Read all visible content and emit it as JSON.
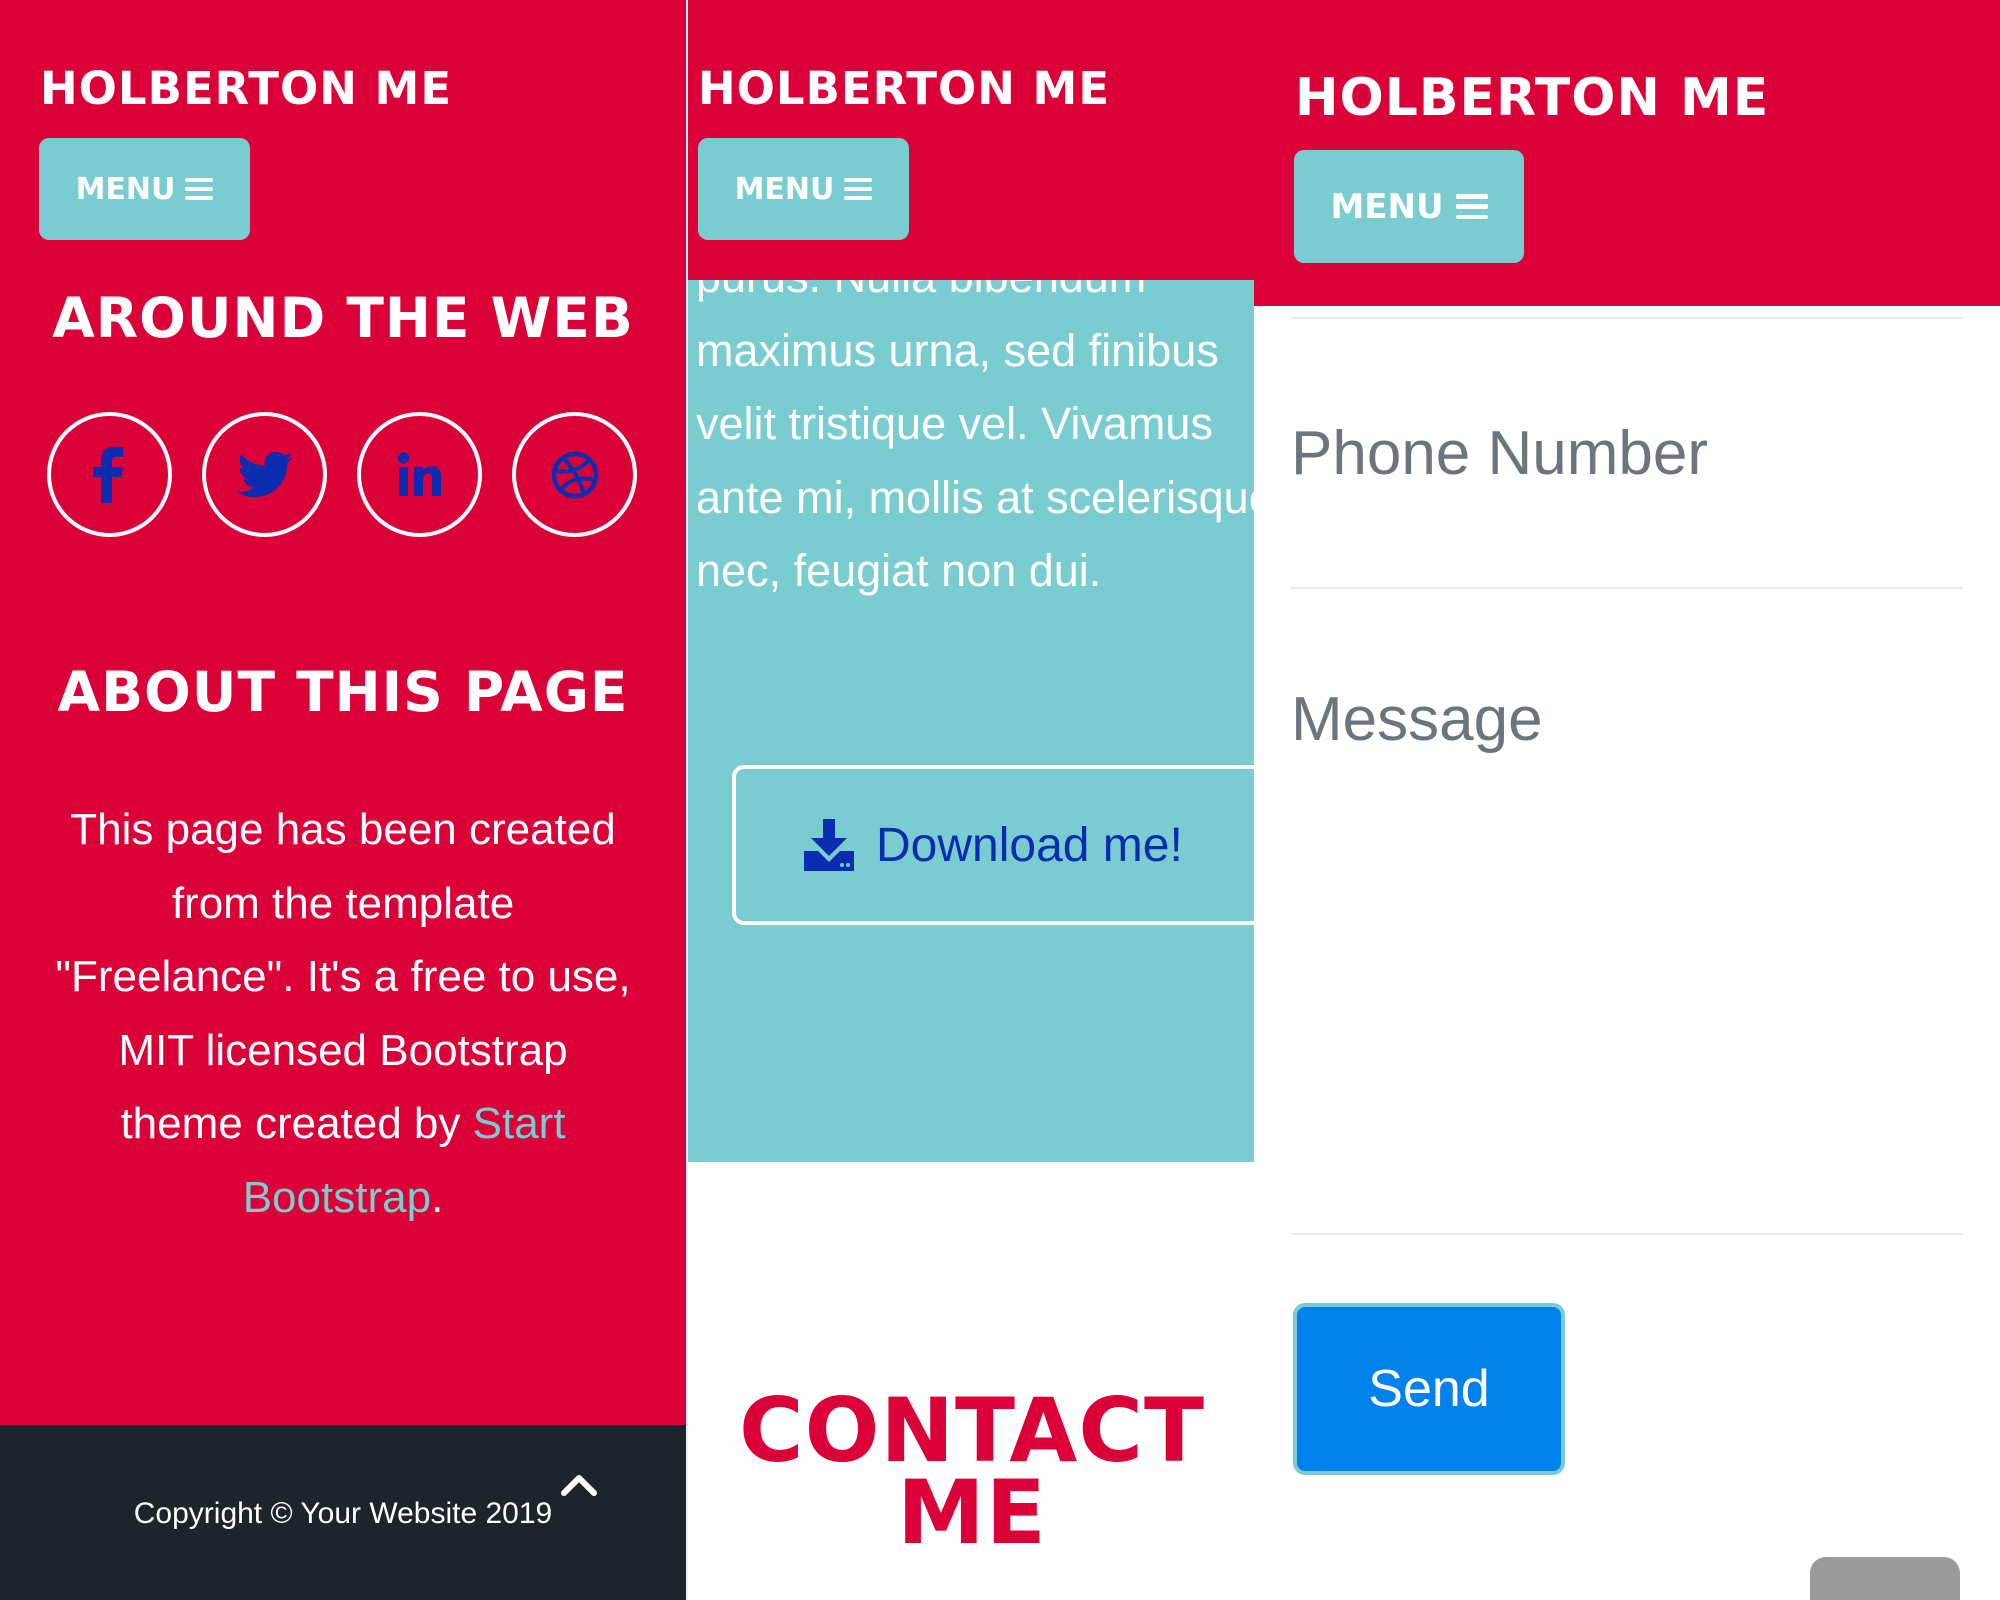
{
  "brand": "HOLBERTON ME",
  "menu_label": "MENU",
  "around_title": "AROUND THE WEB",
  "social_icons": [
    "facebook-icon",
    "twitter-icon",
    "linkedin-icon",
    "dribbble-icon"
  ],
  "about": {
    "title": "ABOUT THIS PAGE",
    "text_lines": [
      "This page has been created",
      "from the template",
      "\"Freelance\". It's a free to use,",
      "MIT licensed Bootstrap",
      "theme created by "
    ],
    "link_part1": "Start",
    "link_part2": "Bootstrap",
    "end": "."
  },
  "footer": {
    "copyright": "Copyright © Your Website 2019",
    "scroll_icon": "chevron-up-icon"
  },
  "lorem_lines": [
    "purus. Nulla bibendum",
    "maximus urna, sed finibus",
    "velit tristique vel. Vivamus",
    "ante mi, mollis at scelerisque",
    "nec, feugiat non dui."
  ],
  "download_label": "Download me!",
  "contact_title_line1": "CONTACT",
  "contact_title_line2": "ME",
  "form": {
    "phone_placeholder": "Phone Number",
    "message_placeholder": "Message",
    "send_label": "Send"
  },
  "colors": {
    "primary": "#dc0039",
    "accent": "#79cccf",
    "link_blue": "#0a2cb0",
    "send_blue": "#0082ea",
    "footer_dark": "#1e242c"
  }
}
